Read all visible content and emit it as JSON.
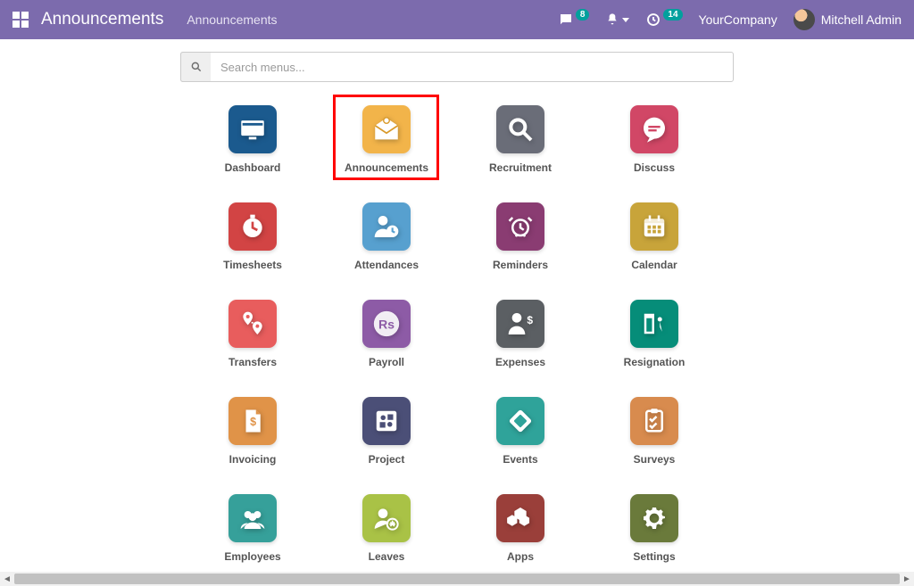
{
  "header": {
    "app_title": "Announcements",
    "breadcrumb": "Announcements",
    "messages_badge": "8",
    "activities_badge": "14",
    "company": "YourCompany",
    "user": "Mitchell Admin"
  },
  "search": {
    "placeholder": "Search menus..."
  },
  "apps": [
    [
      {
        "key": "dashboard",
        "label": "Dashboard",
        "bg": "#1b5a8e"
      },
      {
        "key": "announcements",
        "label": "Announcements",
        "bg": "#f2b44a",
        "highlighted": true
      },
      {
        "key": "recruitment",
        "label": "Recruitment",
        "bg": "#6a6d78"
      },
      {
        "key": "discuss",
        "label": "Discuss",
        "bg": "#d14766"
      }
    ],
    [
      {
        "key": "timesheets",
        "label": "Timesheets",
        "bg": "#d24444"
      },
      {
        "key": "attendances",
        "label": "Attendances",
        "bg": "#57a0cf"
      },
      {
        "key": "reminders",
        "label": "Reminders",
        "bg": "#8a3c72"
      },
      {
        "key": "calendar",
        "label": "Calendar",
        "bg": "#c8a43a"
      }
    ],
    [
      {
        "key": "transfers",
        "label": "Transfers",
        "bg": "#e85d5d"
      },
      {
        "key": "payroll",
        "label": "Payroll",
        "bg": "#8d5ba6"
      },
      {
        "key": "expenses",
        "label": "Expenses",
        "bg": "#5b5f63"
      },
      {
        "key": "resignation",
        "label": "Resignation",
        "bg": "#068d79"
      }
    ],
    [
      {
        "key": "invoicing",
        "label": "Invoicing",
        "bg": "#e09348"
      },
      {
        "key": "project",
        "label": "Project",
        "bg": "#4b4f77"
      },
      {
        "key": "events",
        "label": "Events",
        "bg": "#2fa39a"
      },
      {
        "key": "surveys",
        "label": "Surveys",
        "bg": "#d88b4e"
      }
    ],
    [
      {
        "key": "employees",
        "label": "Employees",
        "bg": "#36a09a"
      },
      {
        "key": "leaves",
        "label": "Leaves",
        "bg": "#a9c246"
      },
      {
        "key": "apps",
        "label": "Apps",
        "bg": "#9a3f3a"
      },
      {
        "key": "settings",
        "label": "Settings",
        "bg": "#6a7a3b"
      }
    ]
  ]
}
